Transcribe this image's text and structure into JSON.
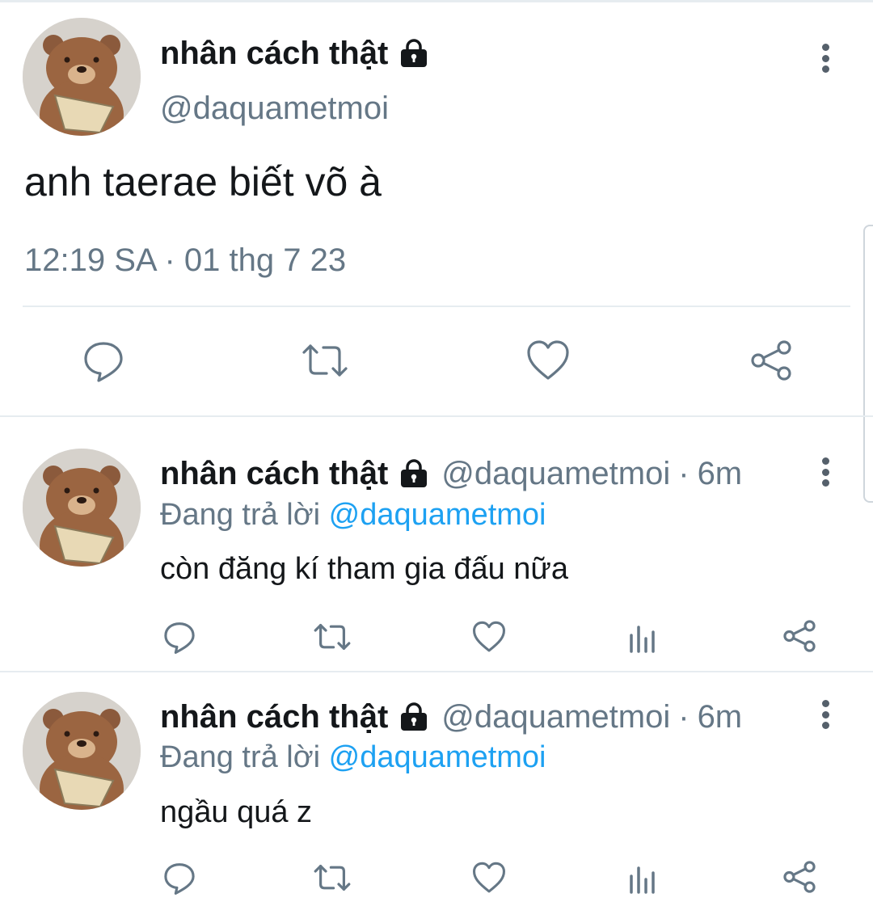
{
  "main_tweet": {
    "display_name": "nhân cách thật",
    "handle": "@daquametmoi",
    "text": "anh taerae biết võ à",
    "timestamp": "12:19 SA · 01 thg 7 23",
    "actions": [
      "reply-icon",
      "retweet-icon",
      "like-icon",
      "share-icon"
    ]
  },
  "replies": [
    {
      "display_name": "nhân cách thật",
      "handle": "@daquametmoi",
      "separator": "·",
      "time": "6m",
      "replying_prefix": "Đang trả lời",
      "replying_to": "@daquametmoi",
      "text": "còn đăng kí tham gia đấu nữa"
    },
    {
      "display_name": "nhân cách thật",
      "handle": "@daquametmoi",
      "separator": "·",
      "time": "6m",
      "replying_prefix": "Đang trả lời",
      "replying_to": "@daquametmoi",
      "text": "ngầu quá z"
    }
  ],
  "colors": {
    "text": "#14171a",
    "secondary": "#657786",
    "mention": "#1da1f2",
    "divider": "#e6ecf0"
  }
}
